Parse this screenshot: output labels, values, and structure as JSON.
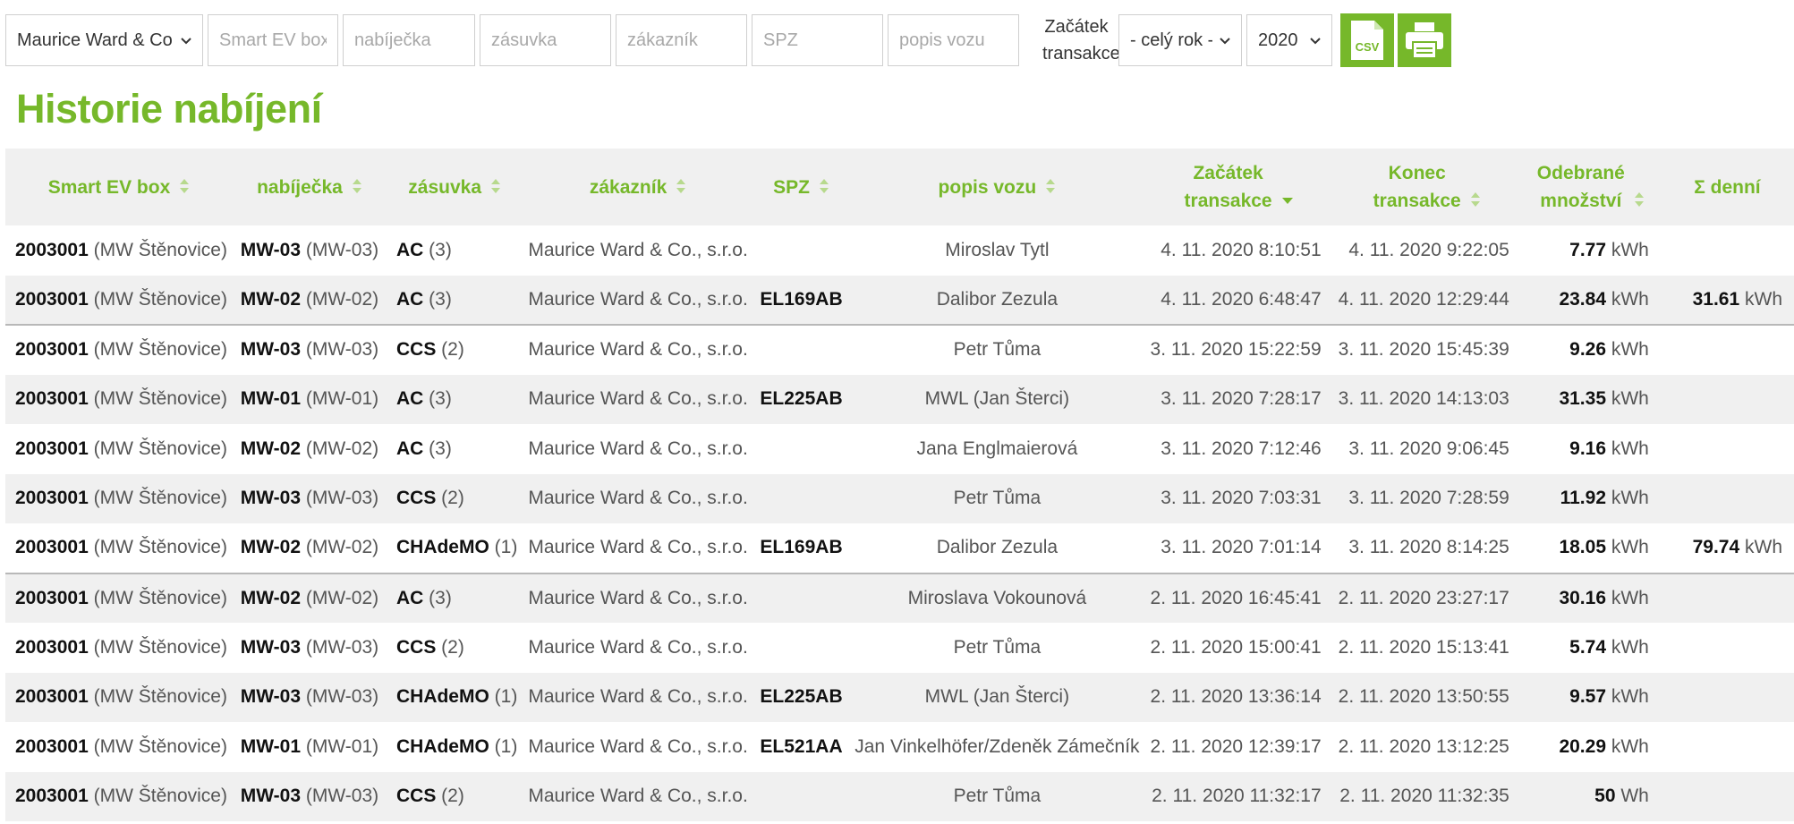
{
  "filters": {
    "company_select": "Maurice Ward & Co., s.r.o.",
    "smart_ev_box_placeholder": "Smart EV box",
    "charger_placeholder": "nabíječka",
    "socket_placeholder": "zásuvka",
    "customer_placeholder": "zákazník",
    "plate_placeholder": "SPZ",
    "vehicle_placeholder": "popis vozu",
    "start_label_line1": "Začátek",
    "start_label_line2": "transakce",
    "period_select": "- celý rok -",
    "year_select": "2020",
    "csv_icon_text": "CSV",
    "icons": [
      "csv-export-icon",
      "printer-icon"
    ]
  },
  "page_title": "Historie nabíjení",
  "accent_color": "#76b82a",
  "table": {
    "headers": {
      "box": "Smart EV box",
      "charger": "nabíječka",
      "socket": "zásuvka",
      "customer": "zákazník",
      "plate": "SPZ",
      "vehicle": "popis vozu",
      "start1": "Začátek",
      "start2": "transakce",
      "end1": "Konec",
      "end2": "transakce",
      "amount1": "Odebrané",
      "amount2": "množství",
      "daily": "Σ denní"
    },
    "rows": [
      {
        "box": "2003001",
        "box_loc": "(MW Štěnovice)",
        "charger": "MW-03",
        "charger_sub": "(MW-03)",
        "socket": "AC",
        "socket_sub": "(3)",
        "customer": "Maurice Ward & Co., s.r.o.",
        "plate": "",
        "vehicle": "Miroslav Tytl",
        "start": "4. 11. 2020 8:10:51",
        "end": "4. 11. 2020 9:22:05",
        "amount": "7.77",
        "unit": "kWh",
        "daily": "",
        "daily_unit": "",
        "sep": false
      },
      {
        "box": "2003001",
        "box_loc": "(MW Štěnovice)",
        "charger": "MW-02",
        "charger_sub": "(MW-02)",
        "socket": "AC",
        "socket_sub": "(3)",
        "customer": "Maurice Ward & Co., s.r.o.",
        "plate": "EL169AB",
        "vehicle": "Dalibor Zezula",
        "start": "4. 11. 2020 6:48:47",
        "end": "4. 11. 2020 12:29:44",
        "amount": "23.84",
        "unit": "kWh",
        "daily": "31.61",
        "daily_unit": "kWh",
        "sep": false
      },
      {
        "box": "2003001",
        "box_loc": "(MW Štěnovice)",
        "charger": "MW-03",
        "charger_sub": "(MW-03)",
        "socket": "CCS",
        "socket_sub": "(2)",
        "customer": "Maurice Ward & Co., s.r.o.",
        "plate": "",
        "vehicle": "Petr Tůma",
        "start": "3. 11. 2020 15:22:59",
        "end": "3. 11. 2020 15:45:39",
        "amount": "9.26",
        "unit": "kWh",
        "daily": "",
        "daily_unit": "",
        "sep": true
      },
      {
        "box": "2003001",
        "box_loc": "(MW Štěnovice)",
        "charger": "MW-01",
        "charger_sub": "(MW-01)",
        "socket": "AC",
        "socket_sub": "(3)",
        "customer": "Maurice Ward & Co., s.r.o.",
        "plate": "EL225AB",
        "vehicle": "MWL (Jan Šterci)",
        "start": "3. 11. 2020 7:28:17",
        "end": "3. 11. 2020 14:13:03",
        "amount": "31.35",
        "unit": "kWh",
        "daily": "",
        "daily_unit": "",
        "sep": false
      },
      {
        "box": "2003001",
        "box_loc": "(MW Štěnovice)",
        "charger": "MW-02",
        "charger_sub": "(MW-02)",
        "socket": "AC",
        "socket_sub": "(3)",
        "customer": "Maurice Ward & Co., s.r.o.",
        "plate": "",
        "vehicle": "Jana Englmaierová",
        "start": "3. 11. 2020 7:12:46",
        "end": "3. 11. 2020 9:06:45",
        "amount": "9.16",
        "unit": "kWh",
        "daily": "",
        "daily_unit": "",
        "sep": false
      },
      {
        "box": "2003001",
        "box_loc": "(MW Štěnovice)",
        "charger": "MW-03",
        "charger_sub": "(MW-03)",
        "socket": "CCS",
        "socket_sub": "(2)",
        "customer": "Maurice Ward & Co., s.r.o.",
        "plate": "",
        "vehicle": "Petr Tůma",
        "start": "3. 11. 2020 7:03:31",
        "end": "3. 11. 2020 7:28:59",
        "amount": "11.92",
        "unit": "kWh",
        "daily": "",
        "daily_unit": "",
        "sep": false
      },
      {
        "box": "2003001",
        "box_loc": "(MW Štěnovice)",
        "charger": "MW-02",
        "charger_sub": "(MW-02)",
        "socket": "CHAdeMO",
        "socket_sub": "(1)",
        "customer": "Maurice Ward & Co., s.r.o.",
        "plate": "EL169AB",
        "vehicle": "Dalibor Zezula",
        "start": "3. 11. 2020 7:01:14",
        "end": "3. 11. 2020 8:14:25",
        "amount": "18.05",
        "unit": "kWh",
        "daily": "79.74",
        "daily_unit": "kWh",
        "sep": false
      },
      {
        "box": "2003001",
        "box_loc": "(MW Štěnovice)",
        "charger": "MW-02",
        "charger_sub": "(MW-02)",
        "socket": "AC",
        "socket_sub": "(3)",
        "customer": "Maurice Ward & Co., s.r.o.",
        "plate": "",
        "vehicle": "Miroslava Vokounová",
        "start": "2. 11. 2020 16:45:41",
        "end": "2. 11. 2020 23:27:17",
        "amount": "30.16",
        "unit": "kWh",
        "daily": "",
        "daily_unit": "",
        "sep": true
      },
      {
        "box": "2003001",
        "box_loc": "(MW Štěnovice)",
        "charger": "MW-03",
        "charger_sub": "(MW-03)",
        "socket": "CCS",
        "socket_sub": "(2)",
        "customer": "Maurice Ward & Co., s.r.o.",
        "plate": "",
        "vehicle": "Petr Tůma",
        "start": "2. 11. 2020 15:00:41",
        "end": "2. 11. 2020 15:13:41",
        "amount": "5.74",
        "unit": "kWh",
        "daily": "",
        "daily_unit": "",
        "sep": false
      },
      {
        "box": "2003001",
        "box_loc": "(MW Štěnovice)",
        "charger": "MW-03",
        "charger_sub": "(MW-03)",
        "socket": "CHAdeMO",
        "socket_sub": "(1)",
        "customer": "Maurice Ward & Co., s.r.o.",
        "plate": "EL225AB",
        "vehicle": "MWL (Jan Šterci)",
        "start": "2. 11. 2020 13:36:14",
        "end": "2. 11. 2020 13:50:55",
        "amount": "9.57",
        "unit": "kWh",
        "daily": "",
        "daily_unit": "",
        "sep": false
      },
      {
        "box": "2003001",
        "box_loc": "(MW Štěnovice)",
        "charger": "MW-01",
        "charger_sub": "(MW-01)",
        "socket": "CHAdeMO",
        "socket_sub": "(1)",
        "customer": "Maurice Ward & Co., s.r.o.",
        "plate": "EL521AA",
        "vehicle": "Jan Vinkelhöfer/Zdeněk Zámečník",
        "start": "2. 11. 2020 12:39:17",
        "end": "2. 11. 2020 13:12:25",
        "amount": "20.29",
        "unit": "kWh",
        "daily": "",
        "daily_unit": "",
        "sep": false
      },
      {
        "box": "2003001",
        "box_loc": "(MW Štěnovice)",
        "charger": "MW-03",
        "charger_sub": "(MW-03)",
        "socket": "CCS",
        "socket_sub": "(2)",
        "customer": "Maurice Ward & Co., s.r.o.",
        "plate": "",
        "vehicle": "Petr Tůma",
        "start": "2. 11. 2020 11:32:17",
        "end": "2. 11. 2020 11:32:35",
        "amount": "50",
        "unit": "Wh",
        "daily": "",
        "daily_unit": "",
        "sep": false
      }
    ]
  }
}
